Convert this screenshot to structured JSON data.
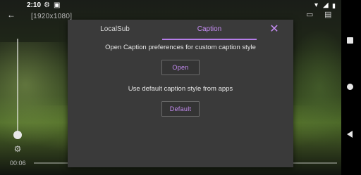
{
  "status_bar": {
    "time": "2:10",
    "icons": [
      "gear-icon",
      "download-icon",
      "wifi-icon",
      "signal-icon",
      "battery-icon"
    ]
  },
  "player": {
    "resolution": "[1920x1080]",
    "elapsed": "00:06",
    "icons": [
      "back-arrow-icon",
      "cast-icon",
      "subtitle-icon",
      "settings-icon"
    ]
  },
  "dialog": {
    "tabs": [
      {
        "label": "LocalSub",
        "selected": false
      },
      {
        "label": "Caption",
        "selected": true
      }
    ],
    "close_icon": "close-icon",
    "open_message": "Open Caption preferences for custom caption style",
    "open_button": "Open",
    "default_message": "Use default caption style from apps",
    "default_button": "Default",
    "accent_color": "#c58cf3"
  },
  "nav_bar": {
    "icons": [
      "recents-icon",
      "home-icon",
      "back-icon"
    ]
  }
}
